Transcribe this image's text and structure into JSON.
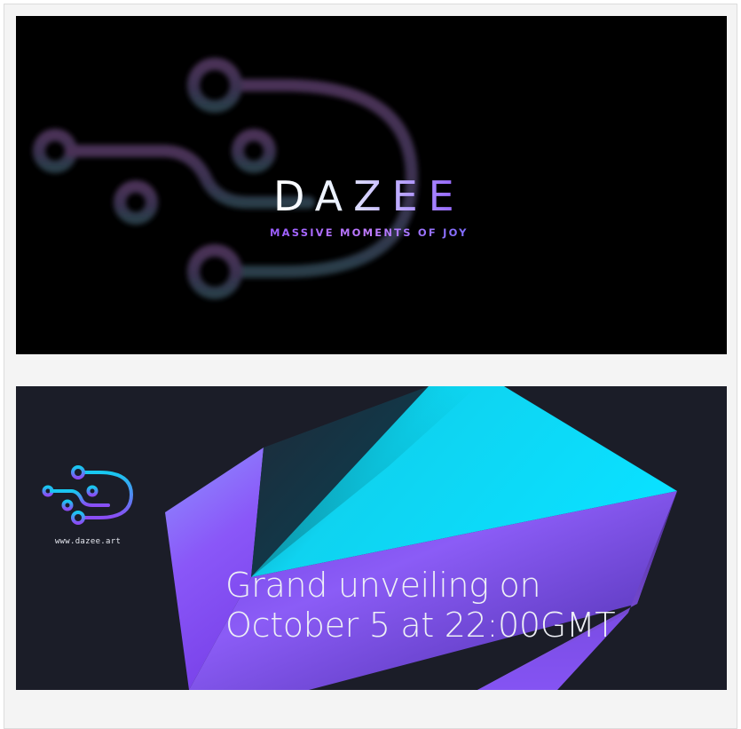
{
  "banner_top": {
    "brand_name": "DAZEE",
    "tagline": "MASSIVE MOMENTS OF JOY",
    "background_color": "#000000",
    "logo_icon": "circuit-d-icon"
  },
  "banner_bottom": {
    "logo_icon": "circuit-d-icon",
    "url_text": "www.dazee.art",
    "headline_line1": "Grand unveiling on",
    "headline_line2": "October 5 at 22:00GMT",
    "background_color": "#1b1d28",
    "accent_colors": [
      "#0ad8f7",
      "#8e5cf7"
    ]
  }
}
